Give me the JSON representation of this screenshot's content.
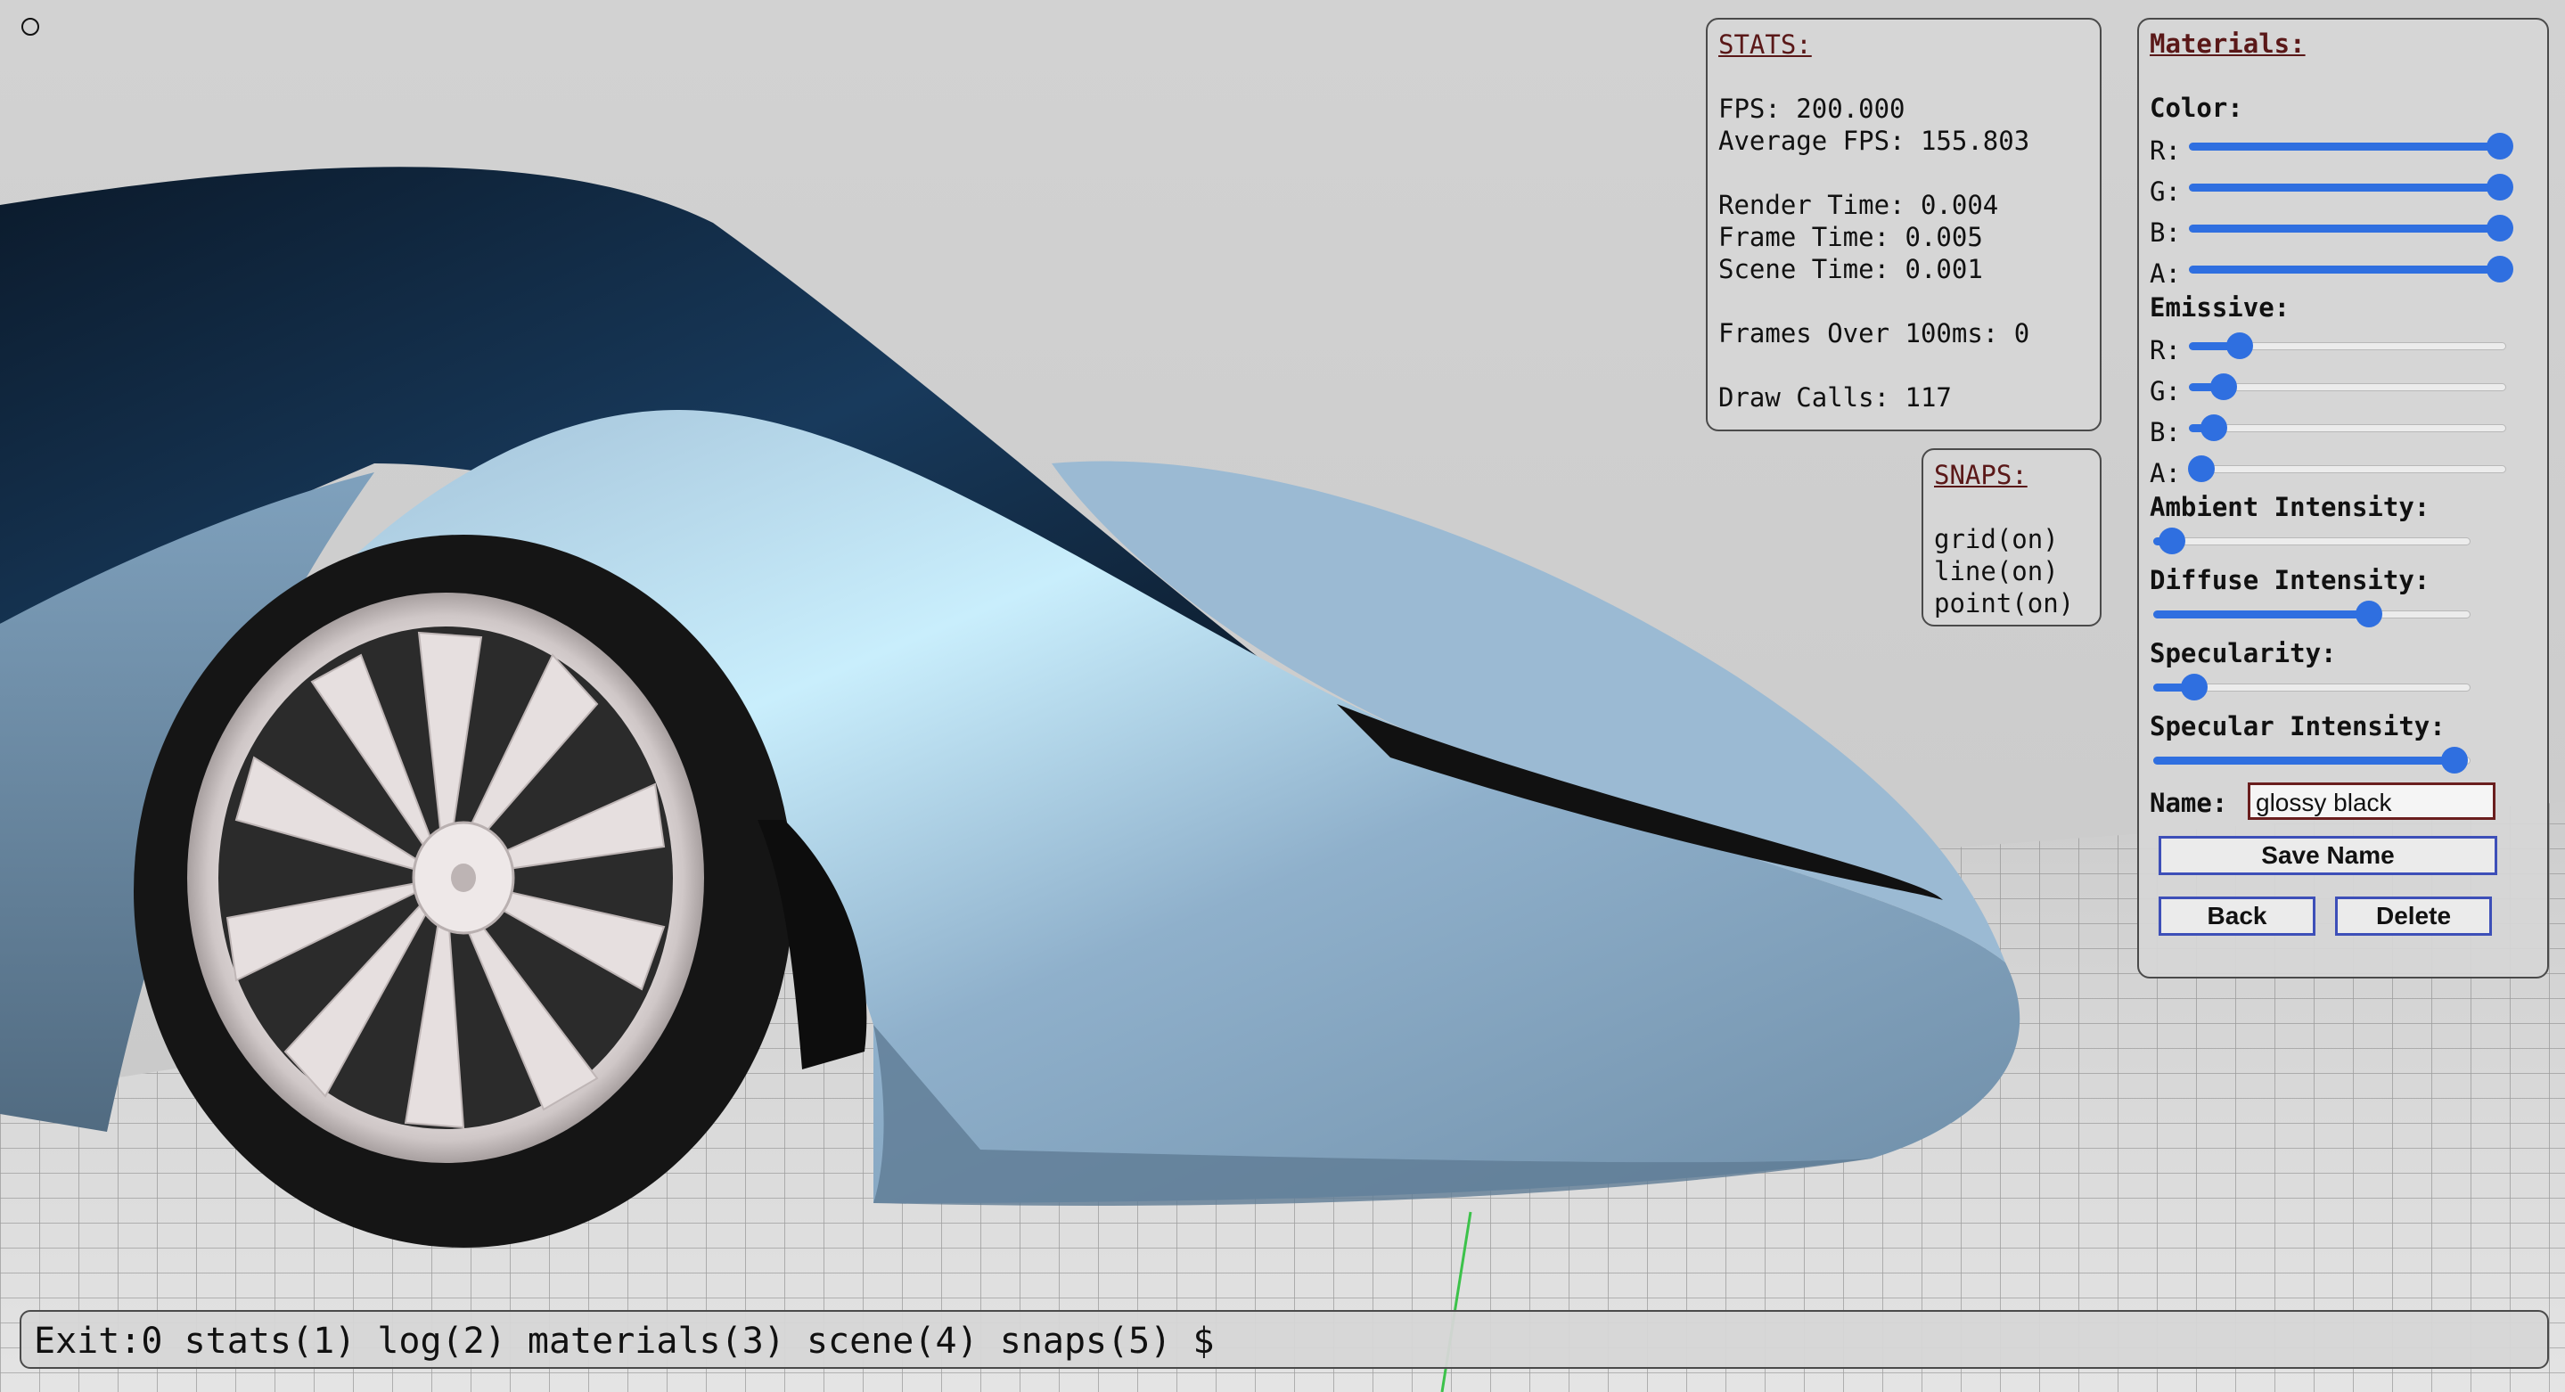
{
  "stats": {
    "heading": "STATS:",
    "fps": "FPS: 200.000",
    "avg_fps": "Average FPS: 155.803",
    "render_time": "Render Time: 0.004",
    "frame_time": "Frame Time: 0.005",
    "scene_time": "Scene Time: 0.001",
    "frames_over": "Frames Over 100ms: 0",
    "draw_calls": "Draw Calls: 117"
  },
  "snaps": {
    "heading": "SNAPS:",
    "grid": "grid(on)",
    "line": "line(on)",
    "point": "point(on)"
  },
  "materials": {
    "title": "Materials:",
    "color_label": "Color:",
    "emissive_label": "Emissive:",
    "ch_r": "R:",
    "ch_g": "G:",
    "ch_b": "B:",
    "ch_a": "A:",
    "color": {
      "r": 0.98,
      "g": 0.98,
      "b": 0.98,
      "a": 0.98
    },
    "emissive": {
      "r": 0.16,
      "g": 0.11,
      "b": 0.08,
      "a": 0.04
    },
    "ambient_label": "Ambient Intensity:",
    "ambient": 0.06,
    "diffuse_label": "Diffuse Intensity:",
    "diffuse": 0.68,
    "specularity_label": "Specularity:",
    "specularity": 0.13,
    "specular_intensity_label": "Specular Intensity:",
    "specular_intensity": 0.95,
    "name_label": "Name:",
    "name_value": "glossy black",
    "save_label": "Save Name",
    "back_label": "Back",
    "delete_label": "Delete"
  },
  "console": {
    "text": "Exit:0 stats(1) log(2) materials(3) scene(4) snaps(5) $"
  },
  "colors": {
    "car_body": "#8fb0cb",
    "car_dark": "#0f2238",
    "accent_blue": "#2f6fe0",
    "background": "#cfcfcf"
  }
}
